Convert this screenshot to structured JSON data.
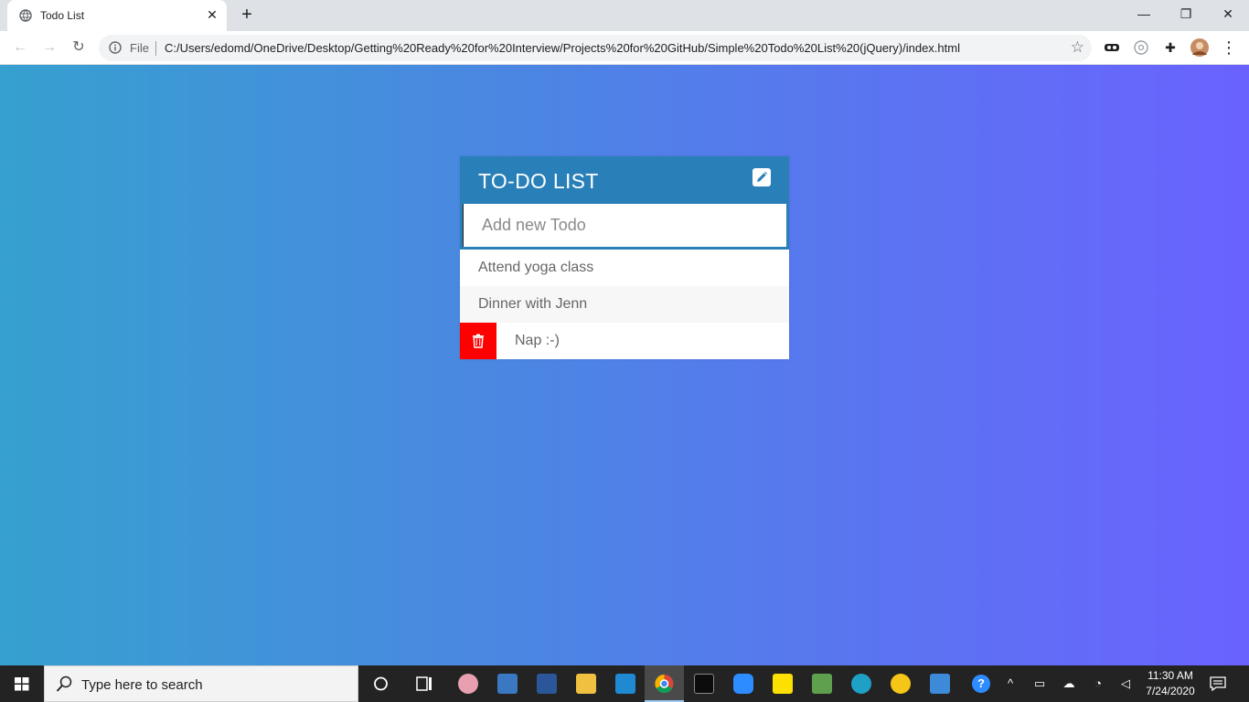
{
  "browser": {
    "tab_title": "Todo List",
    "tab_close": "✕",
    "new_tab": "+",
    "window_buttons": {
      "minimize": "—",
      "restore": "❐",
      "close": "✕"
    },
    "nav": {
      "back": "←",
      "forward": "→",
      "reload": "↻"
    },
    "address": {
      "scheme_label": "File",
      "url": "C:/Users/edomd/OneDrive/Desktop/Getting%20Ready%20for%20Interview/Projects%20for%20GitHub/Simple%20Todo%20List%20(jQuery)/index.html",
      "bookmark": "☆"
    },
    "extensions": {
      "ext_puzzle": "✚",
      "menu": "⋮"
    }
  },
  "page": {
    "background": {
      "from": "#36a0cf",
      "to": "#6a62ff"
    },
    "todo": {
      "title": "TO-DO LIST",
      "header_color": "#2980b9",
      "input_placeholder": "Add new Todo",
      "input_value": "",
      "items": [
        {
          "label": "Attend yoga class",
          "hovered": false
        },
        {
          "label": "Dinner with Jenn",
          "hovered": false
        },
        {
          "label": "Nap :-)",
          "hovered": true
        }
      ],
      "delete_color": "#ff0000"
    }
  },
  "taskbar": {
    "search_placeholder": "Type here to search",
    "clock_time": "11:30 AM",
    "clock_date": "7/24/2020",
    "apps": [
      "cortana-icon",
      "task-view-icon",
      "paint-icon",
      "calculator-icon",
      "word-icon",
      "file-explorer-icon",
      "vscode-icon",
      "chrome-icon",
      "terminal-icon",
      "zoom-icon",
      "sticky-notes-icon",
      "nodejs-icon",
      "edge-icon",
      "rubber-duck-icon",
      "photos-icon"
    ]
  }
}
